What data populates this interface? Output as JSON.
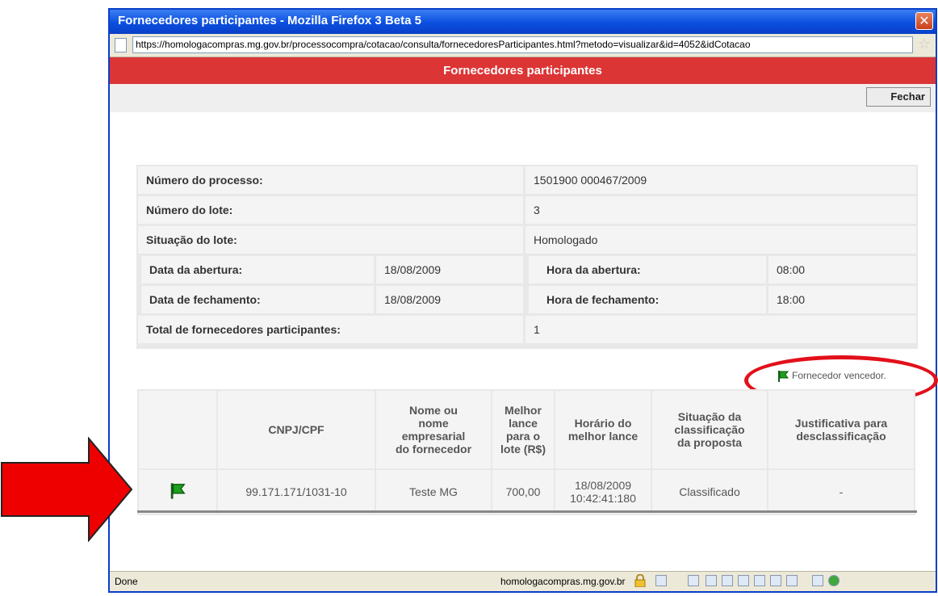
{
  "window": {
    "title": "Fornecedores participantes - Mozilla Firefox 3 Beta 5",
    "close_glyph": "✕"
  },
  "addressbar": {
    "url": "https://homologacompras.mg.gov.br/processocompra/cotacao/consulta/fornecedoresParticipantes.html?metodo=visualizar&id=4052&idCotacao"
  },
  "page": {
    "heading": "Fornecedores participantes",
    "close_button": "Fechar"
  },
  "info": {
    "processo_label": "Número do processo:",
    "processo_value": "1501900 000467/2009",
    "lote_label": "Número do lote:",
    "lote_value": "3",
    "situacao_label": "Situação do lote:",
    "situacao_value": "Homologado",
    "data_abertura_label": "Data da abertura:",
    "data_abertura_value": "18/08/2009",
    "hora_abertura_label": "Hora da abertura:",
    "hora_abertura_value": "08:00",
    "data_fechamento_label": "Data de fechamento:",
    "data_fechamento_value": "18/08/2009",
    "hora_fechamento_label": "Hora de fechamento:",
    "hora_fechamento_value": "18:00",
    "total_label": "Total de fornecedores participantes:",
    "total_value": "1"
  },
  "legend": {
    "label": "Fornecedor vencedor.",
    "icon": "green-flag-icon"
  },
  "table": {
    "headers": {
      "cnpj": "CNPJ/CPF",
      "nome": [
        "Nome ou",
        "nome",
        "empresarial",
        "do fornecedor"
      ],
      "lance": [
        "Melhor",
        "lance",
        "para o",
        "lote (R$)"
      ],
      "horario": [
        "Horário do",
        "melhor lance"
      ],
      "situacao": [
        "Situação da",
        "classificação",
        "da proposta"
      ],
      "justificativa": [
        "Justificativa para",
        "desclassificação"
      ]
    },
    "rows": [
      {
        "cnpj": "99.171.171/1031-10",
        "nome": "Teste MG",
        "lance": "700,00",
        "horario_date": "18/08/2009",
        "horario_time": "10:42:41:180",
        "situacao": "Classificado",
        "justificativa": "-"
      }
    ]
  },
  "statusbar": {
    "status": "Done",
    "domain": "homologacompras.mg.gov.br"
  },
  "colors": {
    "titlebar": "#0b4fe0",
    "heading_band": "#dc3535",
    "annotation_red": "#e2101a",
    "flag_green": "#1fa01f"
  }
}
